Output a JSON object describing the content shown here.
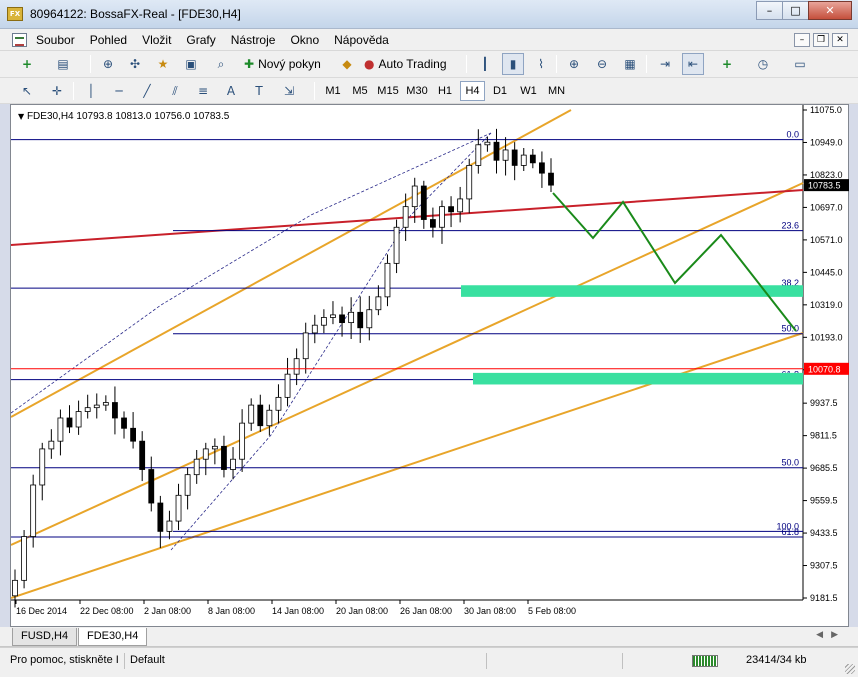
{
  "window": {
    "title": "80964122: BossaFX-Real - [FDE30,H4]",
    "app_icon": "FX"
  },
  "window_buttons": {
    "minimize": "–",
    "maximize": "□",
    "close": "✕"
  },
  "mdi_buttons": {
    "minimize": "–",
    "restore": "❐",
    "close": "✕"
  },
  "menu": {
    "items": [
      "Soubor",
      "Pohled",
      "Vložit",
      "Grafy",
      "Nástroje",
      "Okno",
      "Nápověda"
    ]
  },
  "toolbar": {
    "new_order_label": "Nový pokyn",
    "auto_trading_label": "Auto Trading"
  },
  "timeframes": {
    "items": [
      "M1",
      "M5",
      "M15",
      "M30",
      "H1",
      "H4",
      "D1",
      "W1",
      "MN"
    ],
    "active": "H4"
  },
  "chart": {
    "header": "FDE30,H4  10793.8 10813.0 10756.0 10783.5",
    "current_price_label": "10783.5",
    "level_label": "10070.8",
    "colors": {
      "bull": "#000000",
      "bear": "#000000",
      "channel": "#e8a52a",
      "trend_red": "#c8202a",
      "fib_lines": "#000080",
      "zone": "#39e0a0",
      "projection": "#1a8a1a",
      "price_tag_bg": "#000000",
      "level_tag_bg": "#ff0000"
    }
  },
  "chart_data": {
    "type": "candlestick",
    "symbol": "FDE30",
    "timeframe": "H4",
    "ylim": [
      9181.5,
      11075.0
    ],
    "y_ticks": [
      11075.0,
      10949.0,
      10823.0,
      10697.0,
      10571.0,
      10445.0,
      10319.0,
      10193.0,
      10067.0,
      9937.5,
      9811.5,
      9685.5,
      9559.5,
      9433.5,
      9307.5,
      9181.5
    ],
    "x_ticks": [
      "16 Dec 2014",
      "22 Dec 08:00",
      "2 Jan 08:00",
      "8 Jan 08:00",
      "14 Jan 08:00",
      "20 Jan 08:00",
      "26 Jan 08:00",
      "30 Jan 08:00",
      "5 Feb 08:00"
    ],
    "close_path": [
      9250,
      9420,
      9620,
      9760,
      9790,
      9880,
      9845,
      9905,
      9920,
      9930,
      9940,
      9880,
      9840,
      9790,
      9680,
      9550,
      9440,
      9480,
      9580,
      9660,
      9720,
      9760,
      9770,
      9680,
      9720,
      9860,
      9930,
      9850,
      9910,
      9960,
      10050,
      10110,
      10210,
      10240,
      10270,
      10280,
      10250,
      10290,
      10230,
      10300,
      10350,
      10480,
      10620,
      10700,
      10780,
      10650,
      10620,
      10700,
      10680,
      10730,
      10860,
      10940,
      10950,
      10880,
      10920,
      10860,
      10900,
      10870,
      10830,
      10783.5
    ],
    "fib_levels": [
      {
        "label": "0.0",
        "value": 10960
      },
      {
        "label": "23.6",
        "value": 10607
      },
      {
        "label": "38.2",
        "value": 10384
      },
      {
        "label": "50.0",
        "value": 10207
      },
      {
        "label": "61.8",
        "value": 10029
      },
      {
        "label": "50.0",
        "value": 9687
      },
      {
        "label": "100.0",
        "value": 9440
      },
      {
        "label": "61.8",
        "value": 9418
      }
    ],
    "horizontal_level": 10070.8,
    "current_price": 10783.5
  },
  "tabs": [
    {
      "label": "FUSD,H4",
      "active": false
    },
    {
      "label": "FDE30,H4",
      "active": true
    }
  ],
  "status": {
    "help": "Pro pomoc, stiskněte I",
    "profile": "Default",
    "traffic": "23414/34 kb"
  }
}
